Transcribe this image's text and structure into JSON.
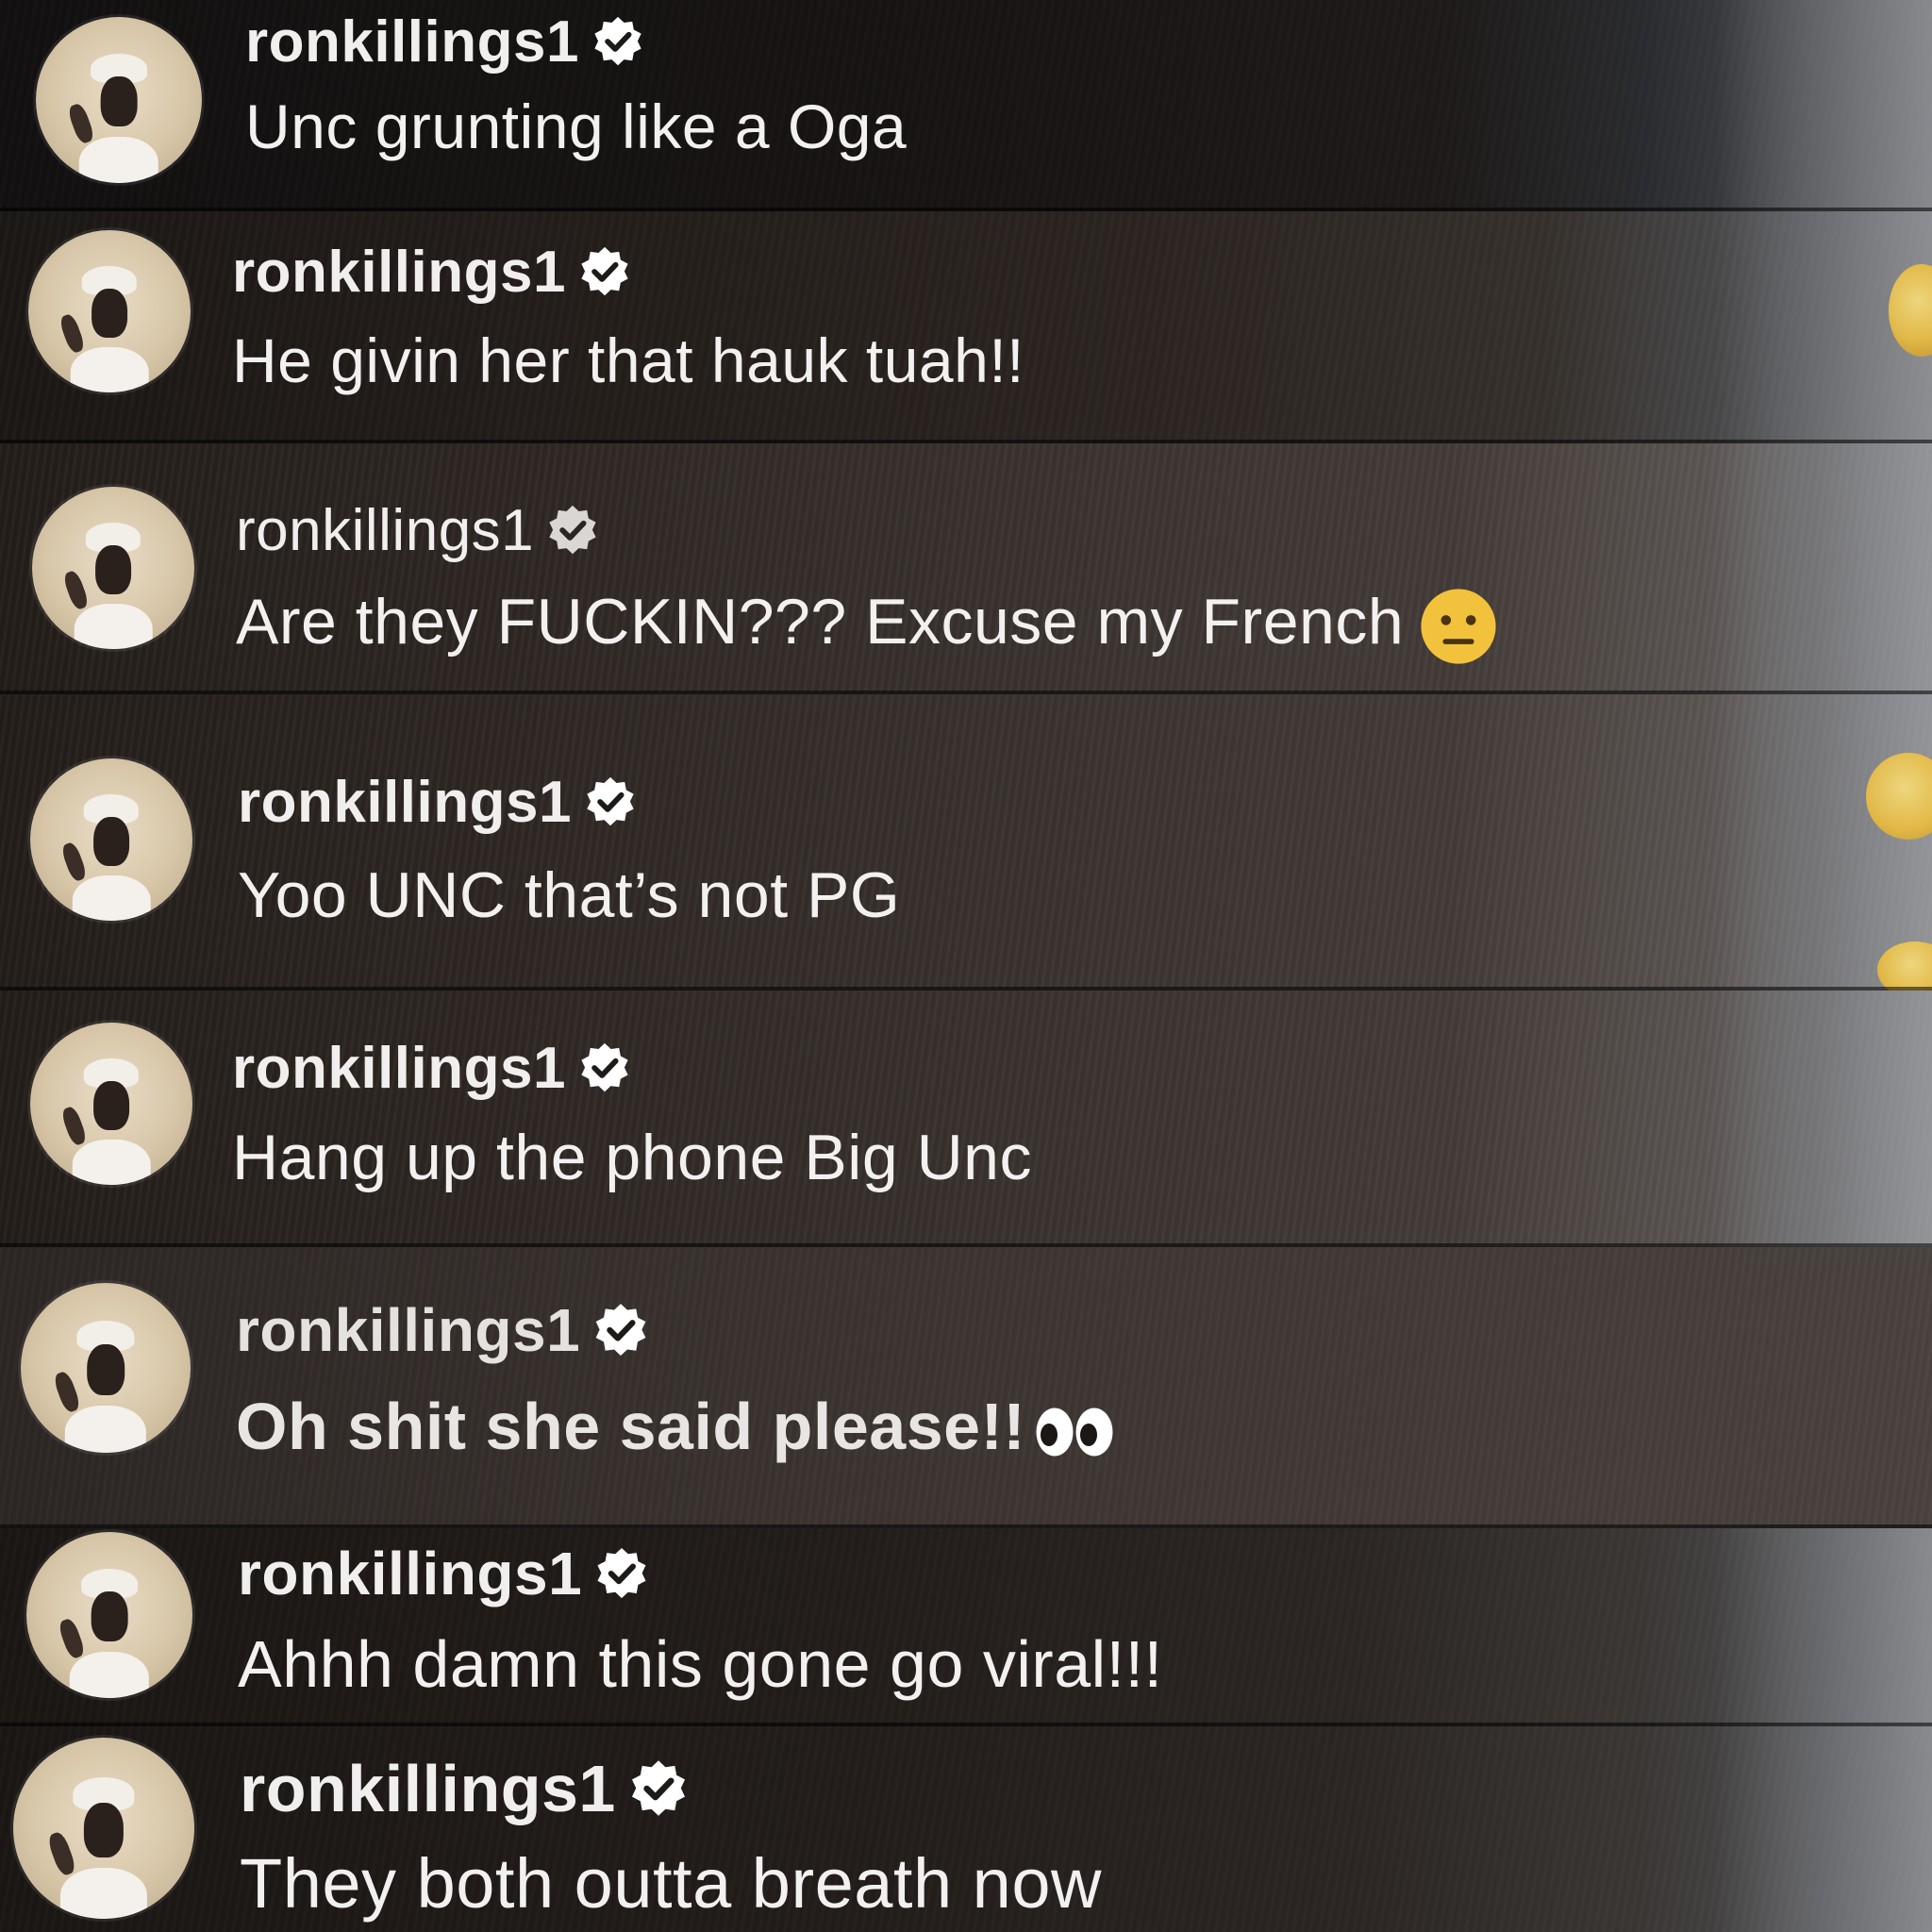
{
  "comments": [
    {
      "username": "ronkillings1",
      "verified": true,
      "message": "Unc grunting like a Oga"
    },
    {
      "username": "ronkillings1",
      "verified": true,
      "message": "He givin her that hauk tuah!!"
    },
    {
      "username": "ronkillings1",
      "verified": true,
      "message": "Are they FUCKIN??? Excuse my French",
      "emoji": "neutral-face-emoji"
    },
    {
      "username": "ronkillings1",
      "verified": true,
      "message": "Yoo UNC that’s not PG"
    },
    {
      "username": "ronkillings1",
      "verified": true,
      "message": "Hang up the phone Big Unc"
    },
    {
      "username": "ronkillings1",
      "verified": true,
      "message": "Oh shit she said please!!",
      "emoji": "eyes-emoji"
    },
    {
      "username": "ronkillings1",
      "verified": true,
      "message": "Ahhh damn this gone go viral!!!"
    },
    {
      "username": "ronkillings1",
      "verified": true,
      "message": "They both outta breath now"
    }
  ],
  "colors": {
    "text": "#f1efee",
    "verified_badge": "#ffffff",
    "verified_check": "#1e1a18",
    "emoji_yellow": "#f3c23c"
  },
  "icons": {
    "verified": "verified-badge-icon",
    "avatar": "profile-avatar"
  }
}
